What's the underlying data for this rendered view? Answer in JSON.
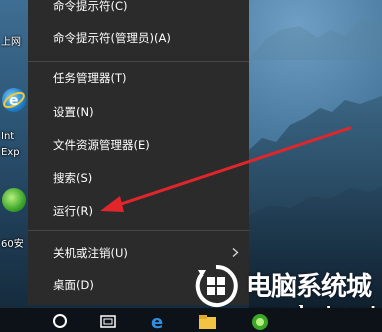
{
  "desktop": {
    "icons": [
      {
        "label": "上网",
        "icon": "network-icon"
      },
      {
        "label": "Int",
        "icon": "internet-explorer-icon"
      },
      {
        "label": "Exp",
        "icon": ""
      },
      {
        "label": "60安",
        "icon": "360-browser-icon"
      }
    ]
  },
  "menu": {
    "items": [
      {
        "label": "命令提示符(C)"
      },
      {
        "label": "命令提示符(管理员)(A)"
      },
      {
        "label": "任务管理器(T)"
      },
      {
        "label": "设置(N)"
      },
      {
        "label": "文件资源管理器(E)"
      },
      {
        "label": "搜索(S)"
      },
      {
        "label": "运行(R)"
      },
      {
        "label": "关机或注销(U)",
        "has_submenu": true
      },
      {
        "label": "桌面(D)"
      }
    ]
  },
  "annotation": {
    "arrow_color": "#e0262b"
  },
  "taskbar": {
    "icons": [
      "start-circle-icon",
      "task-view-icon",
      "edge-icon",
      "file-explorer-icon",
      "360-browser-icon"
    ]
  },
  "watermark": {
    "title": "电脑系统城",
    "url": "www.dnxtc.net"
  },
  "colors": {
    "menu_bg": "#2b2b2b",
    "separator": "#474747",
    "taskbar": "#0c1218",
    "arrow": "#e0262b"
  }
}
